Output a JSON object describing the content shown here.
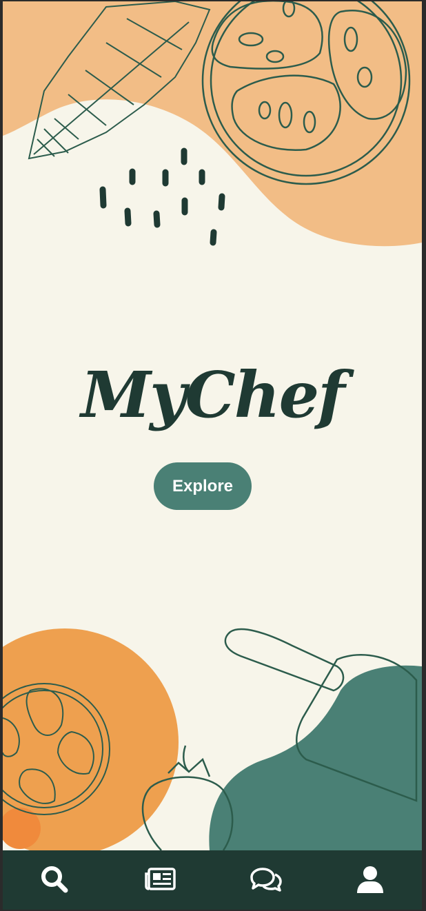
{
  "app": {
    "title": "MyChef"
  },
  "hero": {
    "explore_label": "Explore"
  },
  "tabbar": {
    "items": [
      {
        "icon": "search-icon"
      },
      {
        "icon": "newspaper-icon"
      },
      {
        "icon": "chat-icon"
      },
      {
        "icon": "user-icon"
      }
    ]
  },
  "colors": {
    "background": "#f7f5ea",
    "brand_text": "#1f3a33",
    "button": "#4a8075",
    "tabbar": "#1f3a33",
    "peach": "#f2bd86",
    "orange": "#eea04f",
    "green": "#4a8075"
  }
}
